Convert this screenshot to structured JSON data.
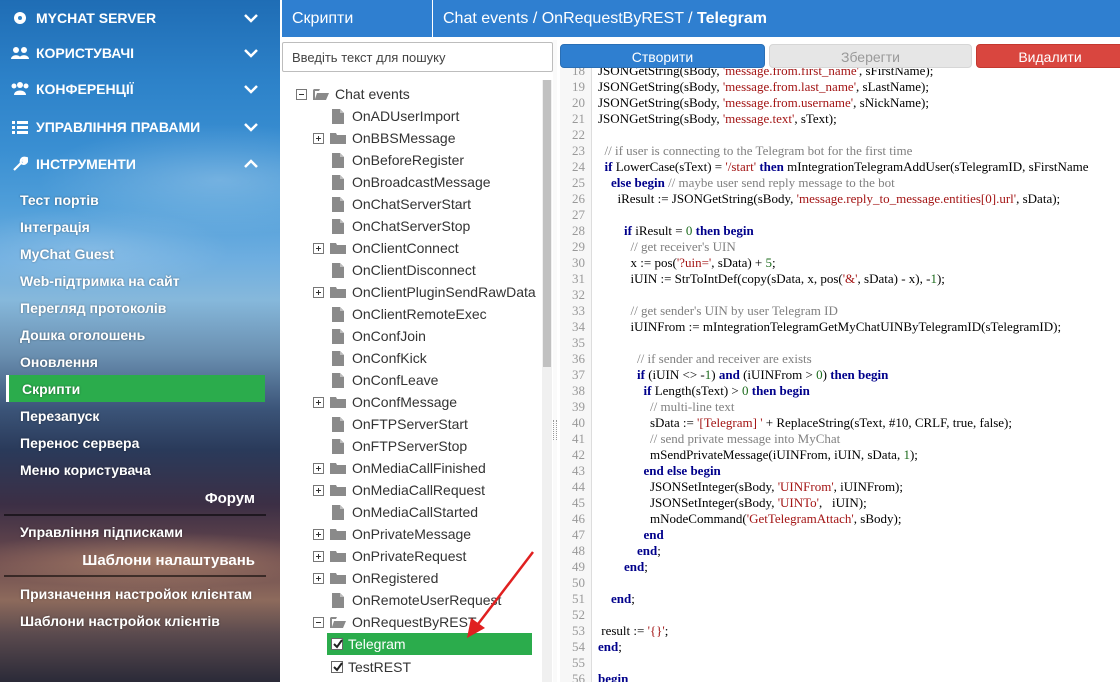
{
  "sidebar": {
    "main": [
      {
        "label": "MYCHAT SERVER",
        "icon": "server-icon",
        "chevron": "down"
      },
      {
        "label": "КОРИСТУВАЧІ",
        "icon": "users-icon",
        "chevron": "down"
      },
      {
        "label": "КОНФЕРЕНЦІЇ",
        "icon": "conferences-icon",
        "chevron": "down"
      },
      {
        "label": "УПРАВЛІННЯ ПРАВАМИ",
        "icon": "list-icon",
        "chevron": "down"
      },
      {
        "label": "ІНСТРУМЕНТИ",
        "icon": "wrench-icon",
        "chevron": "up"
      }
    ],
    "tools": [
      "Тест портів",
      "Інтеграція",
      "MyChat Guest",
      "Web-підтримка на сайт",
      "Перегляд протоколів",
      "Дошка оголошень",
      "Оновлення",
      "Скрипти",
      "Перезапуск",
      "Перенос сервера",
      "Меню користувача"
    ],
    "active_tool": "Скрипти",
    "forum": "Форум",
    "subscriptions": "Управління підписками",
    "settings_templates": "Шаблони налаштувань",
    "client_settings_assign": "Призначення настройок клієнтам",
    "client_settings_templates": "Шаблони настройок клієнтів"
  },
  "header": {
    "section": "Скрипти",
    "breadcrumb": "Chat events / OnRequestByREST / ",
    "breadcrumb_current": "Telegram"
  },
  "search": {
    "placeholder": "Введіть текст для пошуку"
  },
  "tree": {
    "root": "Chat events",
    "events": [
      {
        "label": "OnADUserImport",
        "expandable": false
      },
      {
        "label": "OnBBSMessage",
        "expandable": true
      },
      {
        "label": "OnBeforeRegister",
        "expandable": false
      },
      {
        "label": "OnBroadcastMessage",
        "expandable": false
      },
      {
        "label": "OnChatServerStart",
        "expandable": false
      },
      {
        "label": "OnChatServerStop",
        "expandable": false
      },
      {
        "label": "OnClientConnect",
        "expandable": true
      },
      {
        "label": "OnClientDisconnect",
        "expandable": false
      },
      {
        "label": "OnClientPluginSendRawData",
        "expandable": true
      },
      {
        "label": "OnClientRemoteExec",
        "expandable": false
      },
      {
        "label": "OnConfJoin",
        "expandable": false
      },
      {
        "label": "OnConfKick",
        "expandable": false
      },
      {
        "label": "OnConfLeave",
        "expandable": false
      },
      {
        "label": "OnConfMessage",
        "expandable": true
      },
      {
        "label": "OnFTPServerStart",
        "expandable": false
      },
      {
        "label": "OnFTPServerStop",
        "expandable": false
      },
      {
        "label": "OnMediaCallFinished",
        "expandable": true
      },
      {
        "label": "OnMediaCallRequest",
        "expandable": true
      },
      {
        "label": "OnMediaCallStarted",
        "expandable": false
      },
      {
        "label": "OnPrivateMessage",
        "expandable": true
      },
      {
        "label": "OnPrivateRequest",
        "expandable": true
      },
      {
        "label": "OnRegistered",
        "expandable": true
      },
      {
        "label": "OnRemoteUserRequest",
        "expandable": false
      },
      {
        "label": "OnRequestByREST",
        "expandable": true,
        "expanded": true
      }
    ],
    "scripts": [
      {
        "label": "Telegram",
        "checked": true,
        "selected": true
      },
      {
        "label": "TestREST",
        "checked": true,
        "selected": false
      }
    ]
  },
  "buttons": {
    "create": "Створити",
    "save": "Зберегти",
    "delete": "Видалити"
  },
  "code": {
    "lines": [
      {
        "n": "18",
        "html": "JSONGetString(sBody, <span class=\"str\">'message.from.first_name'</span>, sFirstName);"
      },
      {
        "n": "19",
        "html": "JSONGetString(sBody, <span class=\"str\">'message.from.last_name'</span>, sLastName);"
      },
      {
        "n": "20",
        "html": "JSONGetString(sBody, <span class=\"str\">'message.from.username'</span>, sNickName);"
      },
      {
        "n": "21",
        "html": "JSONGetString(sBody, <span class=\"str\">'message.text'</span>, sText);"
      },
      {
        "n": "22",
        "html": ""
      },
      {
        "n": "23",
        "html": "  <span class=\"cmt\">// if user is connecting to the Telegram bot for the first time</span>"
      },
      {
        "n": "24",
        "html": "  <span class=\"kw\">if</span> LowerCase(sText) = <span class=\"str\">'/start'</span> <span class=\"kw\">then</span> mIntegrationTelegramAddUser(sTelegramID, sFirstName"
      },
      {
        "n": "25",
        "html": "    <span class=\"kw\">else begin</span> <span class=\"cmt\">// maybe user send reply message to the bot</span>"
      },
      {
        "n": "26",
        "html": "      iResult := JSONGetString(sBody, <span class=\"str\">'message.reply_to_message.entities[0].url'</span>, sData);"
      },
      {
        "n": "27",
        "html": ""
      },
      {
        "n": "28",
        "html": "        <span class=\"kw\">if</span> iResult = <span class=\"num\">0</span> <span class=\"kw\">then begin</span>"
      },
      {
        "n": "29",
        "html": "          <span class=\"cmt\">// get receiver's UIN</span>"
      },
      {
        "n": "30",
        "html": "          x := pos(<span class=\"str\">'?uin='</span>, sData) + <span class=\"num\">5</span>;"
      },
      {
        "n": "31",
        "html": "          iUIN := StrToIntDef(copy(sData, x, pos(<span class=\"str\">'&amp;'</span>, sData) - x), -<span class=\"num\">1</span>);"
      },
      {
        "n": "32",
        "html": ""
      },
      {
        "n": "33",
        "html": "          <span class=\"cmt\">// get sender's UIN by user Telegram ID</span>"
      },
      {
        "n": "34",
        "html": "          iUINFrom := mIntegrationTelegramGetMyChatUINByTelegramID(sTelegramID);"
      },
      {
        "n": "35",
        "html": ""
      },
      {
        "n": "36",
        "html": "            <span class=\"cmt\">// if sender and receiver are exists</span>"
      },
      {
        "n": "37",
        "html": "            <span class=\"kw\">if</span> (iUIN &lt;&gt; -<span class=\"num\">1</span>) <span class=\"kw\">and</span> (iUINFrom &gt; <span class=\"num\">0</span>) <span class=\"kw\">then begin</span>"
      },
      {
        "n": "38",
        "html": "              <span class=\"kw\">if</span> Length(sText) &gt; <span class=\"num\">0</span> <span class=\"kw\">then begin</span>"
      },
      {
        "n": "39",
        "html": "                <span class=\"cmt\">// multi-line text</span>"
      },
      {
        "n": "40",
        "html": "                sData := <span class=\"str\">'[Telegram] '</span> + ReplaceString(sText, #10, CRLF, true, false);"
      },
      {
        "n": "41",
        "html": "                <span class=\"cmt\">// send private message into MyChat</span>"
      },
      {
        "n": "42",
        "html": "                mSendPrivateMessage(iUINFrom, iUIN, sData, <span class=\"num\">1</span>);"
      },
      {
        "n": "43",
        "html": "              <span class=\"kw\">end else begin</span>"
      },
      {
        "n": "44",
        "html": "                JSONSetInteger(sBody, <span class=\"str\">'UINFrom'</span>, iUINFrom);"
      },
      {
        "n": "45",
        "html": "                JSONSetInteger(sBody, <span class=\"str\">'UINTo'</span>,   iUIN);"
      },
      {
        "n": "46",
        "html": "                mNodeCommand(<span class=\"str\">'GetTelegramAttach'</span>, sBody);"
      },
      {
        "n": "47",
        "html": "              <span class=\"kw\">end</span>"
      },
      {
        "n": "48",
        "html": "            <span class=\"kw\">end</span>;"
      },
      {
        "n": "49",
        "html": "        <span class=\"kw\">end</span>;"
      },
      {
        "n": "50",
        "html": ""
      },
      {
        "n": "51",
        "html": "    <span class=\"kw\">end</span>;"
      },
      {
        "n": "52",
        "html": ""
      },
      {
        "n": "53",
        "html": " result := <span class=\"str\">'{}'</span>;"
      },
      {
        "n": "54",
        "html": "<span class=\"kw\">end</span>;"
      },
      {
        "n": "55",
        "html": ""
      },
      {
        "n": "56",
        "html": "<span class=\"kw\">begin</span>"
      }
    ]
  },
  "colors": {
    "accent_blue": "#2f7fd0",
    "active_green": "#2bac4c",
    "delete_red": "#d9463f",
    "annotation_red": "#e02020"
  }
}
